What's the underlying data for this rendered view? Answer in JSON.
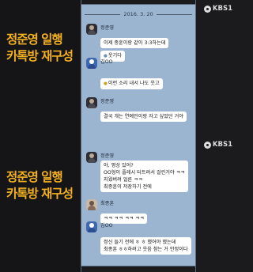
{
  "broadcaster": "KBS1",
  "top": {
    "caption_line1": "정준영 일행",
    "caption_line2": "카톡방 재구성",
    "date": "2016. 3. 20",
    "messages": [
      {
        "sender": "정준영",
        "lines": [
          "이제 종훈이랑 같이 3:3하는데"
        ]
      },
      {
        "sender": "김OO",
        "lines": [
          "웃기다"
        ]
      },
      {
        "sender": "",
        "lines": [
          "이런 소리 내서 나도 웃고"
        ]
      },
      {
        "sender": "정준영",
        "lines": [
          "결국 걔는 연예인이랑 자고 싶었던 거야"
        ]
      }
    ]
  },
  "bottom": {
    "caption_line1": "정준영 일행",
    "caption_line2": "카톡방 재구성",
    "messages": [
      {
        "sender": "정준영",
        "lines": [
          "아, 영상 있어?",
          "OO형이 플레시 터트려서 걸린거야 ㅋㅋ",
          "지웠버려 얼른 ㅋㅋ",
          "최종훈이 저장하기 전에"
        ]
      },
      {
        "sender": "최종훈",
        "lines": [
          "ㅋㅋ ㅋㅋ ㅋㅋ ㅋㅋ"
        ]
      },
      {
        "sender": "김OO",
        "lines": [
          "정신 들기 전에 ㅎ ㅎ 했어야 했는데",
          "최종훈 ㅎㅎ하려고 웃음 참는 거 안정이다"
        ]
      }
    ]
  }
}
